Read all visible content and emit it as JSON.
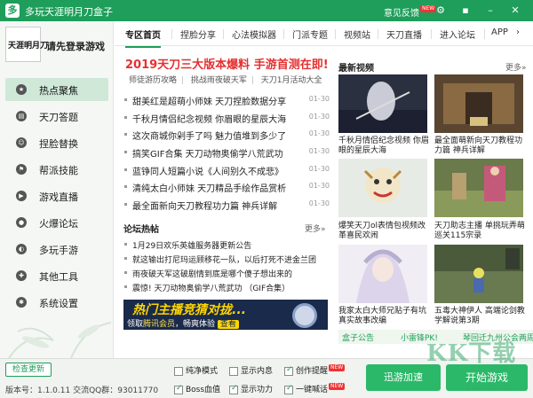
{
  "app": {
    "title": "多玩天涯明月刀盒子",
    "feedback": "意见反馈",
    "feedback_badge": "NEW"
  },
  "user": {
    "avatar_text": "天涯明月刀",
    "login_prompt": "请先登录游戏"
  },
  "sidebar": {
    "items": [
      {
        "label": "热点聚焦",
        "icon": "star-icon",
        "active": true
      },
      {
        "label": "天刀答题",
        "icon": "quiz-icon"
      },
      {
        "label": "捏脸替换",
        "icon": "face-icon"
      },
      {
        "label": "帮派技能",
        "icon": "guild-skill-icon"
      },
      {
        "label": "游戏直播",
        "icon": "live-icon"
      },
      {
        "label": "火爆论坛",
        "icon": "forum-icon"
      },
      {
        "label": "多玩手游",
        "icon": "mobile-game-icon"
      },
      {
        "label": "其他工具",
        "icon": "tools-icon"
      },
      {
        "label": "系统设置",
        "icon": "settings-icon"
      }
    ]
  },
  "tabs": [
    "专区首页",
    "捏脸分享",
    "心法模拟器",
    "门派专题",
    "视频站",
    "天刀直播",
    "进入论坛",
    "APP"
  ],
  "headline": "2019天刀三大版本爆料  手游首测在即!",
  "sublinks": [
    "师徒游历攻略",
    "挑战雨夜破天军",
    "天刀1月活动大全"
  ],
  "news": [
    {
      "title": "甜美红是超萌小师妹 天刀捏脸数据分享",
      "date": "01-30"
    },
    {
      "title": "千秋月情侣纪念视频 你眉眼的星辰大海",
      "date": "01-30"
    },
    {
      "title": "这次商城你剁手了吗 魅力值堆到多少了",
      "date": "01-30"
    },
    {
      "title": "搞笑GIF合集 天刀动物奥偷学八荒武功",
      "date": "01-30"
    },
    {
      "title": "蓝铮同人短篇小说《人间别久不成悲》",
      "date": "01-30"
    },
    {
      "title": "清纯太白小师妹 天刀精品手绘作品赏析",
      "date": "01-30"
    },
    {
      "title": "最全面新向天刀教程功力篇 神兵详解",
      "date": "01-30"
    }
  ],
  "forum": {
    "title": "论坛热帖",
    "more": "更多»",
    "posts": [
      "1月29日欢乐英雄服务器更新公告",
      "就这输出打尼玛运顾移花一队，以后打死不进金兰团",
      "雨夜破天军这破剧情到底是哪个傻子想出来的",
      "震惊! 天刀动物奥偷学八荒武功 （GIF合集）"
    ]
  },
  "banner": {
    "title": "热门主播竞猜对拢...",
    "line_prefix": "领取",
    "line_em": "腾讯会员",
    "line_suffix": "，畅爽体验",
    "tag": "查看"
  },
  "videos": {
    "title": "最新视频",
    "more": "更多»",
    "items": [
      {
        "caption": "千秋月情侣纪念视频 你眉眼的星辰大海"
      },
      {
        "caption": "最全面萌新向天刀教程功力篇 神兵详解"
      },
      {
        "caption": "爆笑天刀ol表情包视频改革喜民欢闹"
      },
      {
        "caption": "天刀助志主播 单挑玩弄萌巡关115宗录"
      },
      {
        "caption": "我家太白大师兄贴子有坑 真实故事改编"
      },
      {
        "caption": "五毒大神伊人 高端论剑教学解说第3期"
      }
    ]
  },
  "ticker": [
    "盒子公告",
    "小雷锋PK!",
    "琴回迁九州公会两周年"
  ],
  "footer": {
    "check_update": "检查更新",
    "version": "版本号：1.1.0.11  交流QQ群：93011770",
    "checkboxes": [
      {
        "label": "纯净模式",
        "checked": false
      },
      {
        "label": "显示内息",
        "checked": false
      },
      {
        "label": "创作提醒",
        "checked": true,
        "badge": "NEW"
      },
      {
        "label": "Boss血值",
        "checked": true
      },
      {
        "label": "显示功力",
        "checked": true
      },
      {
        "label": "一键喊话",
        "checked": true,
        "badge": "NEW"
      }
    ],
    "fast_button": "迅游加速",
    "start_button": "开始游戏"
  },
  "watermark": {
    "text": "KK下载",
    "sub": "www.kkx.net"
  },
  "colors": {
    "brand": "#1e9e5a",
    "headline": "#e53030",
    "active_nav": "#cfe8d8"
  }
}
